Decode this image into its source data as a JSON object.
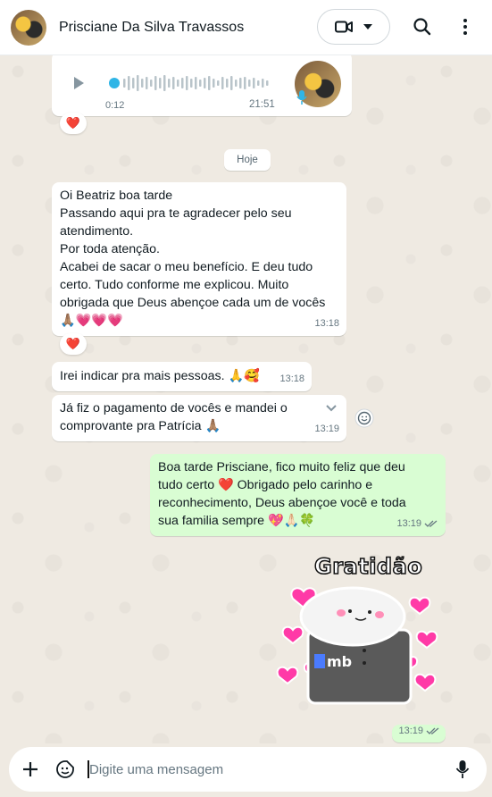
{
  "header": {
    "contact_name": "Prisciane Da Silva Travassos",
    "video_icon": "video-camera-icon",
    "dropdown_icon": "chevron-down-icon",
    "search_icon": "search-icon",
    "menu_icon": "more-vertical-icon"
  },
  "audio_message": {
    "duration": "0:12",
    "time": "21:51",
    "reaction": "❤️"
  },
  "day_separator": "Hoje",
  "messages": [
    {
      "direction": "in",
      "text": "Oi Beatriz boa tarde\nPassando aqui pra te agradecer pelo seu atendimento.\nPor toda atenção.\nAcabei de sacar o meu benefício. E deu tudo certo. Tudo conforme me explicou. Muito obrigada que Deus abençoe cada um de vocês 🙏🏽💗💗💗",
      "time": "13:18",
      "reaction": "❤️"
    },
    {
      "direction": "in",
      "text": "Irei indicar pra mais pessoas. 🙏🥰",
      "time": "13:18"
    },
    {
      "direction": "in",
      "text": "Já fiz o pagamento de vocês e mandei o comprovante pra Patrícia 🙏🏽",
      "time": "13:19"
    },
    {
      "direction": "out",
      "text": "Boa tarde Prisciane, fico muito feliz que deu tudo certo ❤️ Obrigado pelo carinho e reconhecimento, Deus abençoe você e toda sua familia sempre 💖🙏🏻🍀",
      "time": "13:19"
    }
  ],
  "sticker": {
    "title": "Gratidão",
    "brand": "mb",
    "time": "13:19"
  },
  "composer": {
    "placeholder": "Digite uma mensagem"
  },
  "colors": {
    "outgoing_bubble": "#d9fdd3",
    "incoming_bubble": "#ffffff",
    "read_ticks": "#53bdeb",
    "audio_dot": "#2fb5e6"
  }
}
